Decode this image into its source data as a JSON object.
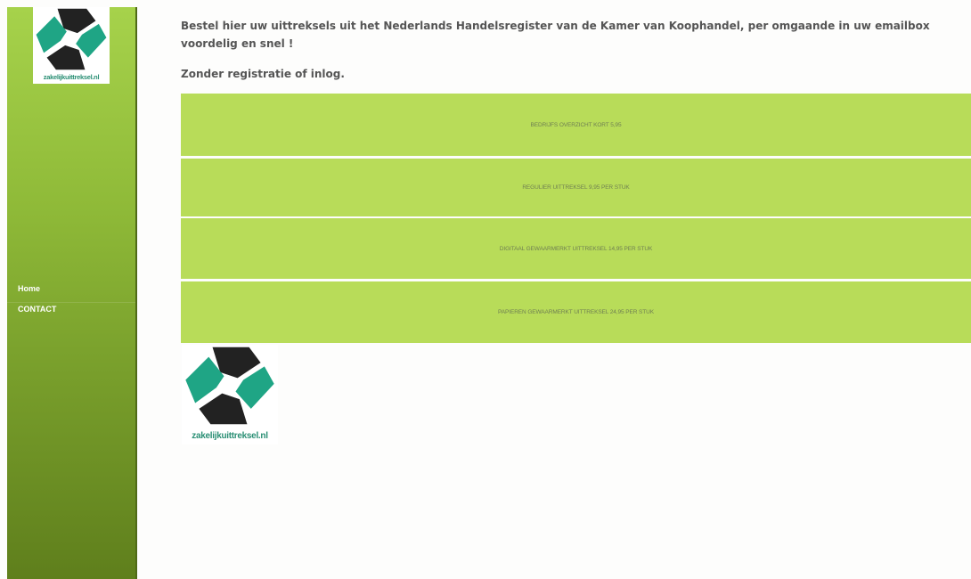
{
  "sidebar": {
    "logo_text": "zakelijkuittreksel.nl",
    "nav": [
      {
        "label": "Home"
      },
      {
        "label": "CONTACT"
      }
    ]
  },
  "main": {
    "intro": "Bestel hier uw uittreksels uit het Nederlands Handelsregister van de Kamer van Koophandel, per omgaande in uw emailbox voordelig en snel !",
    "subintro": "Zonder registratie of inlog.",
    "buttons": [
      {
        "label": "BEDRIJFS OVERZICHT KORT 5,95"
      },
      {
        "label": "REGULIER UITTREKSEL 9,95 PER STUK"
      },
      {
        "label": "DIGITAAL GEWAARMERKT UITTREKSEL 14,95 PER STUK"
      },
      {
        "label": "PAPIEREN GEWAARMERKT UITTREKSEL 24,95 PER STUK"
      }
    ],
    "logo_text": "zakelijkuittreksel.nl"
  },
  "colors": {
    "button_bg": "#b8dc59",
    "sidebar_top": "#a6d24b",
    "sidebar_bottom": "#5f7f1c",
    "logo_teal": "#1fa585",
    "logo_dark": "#222222"
  }
}
